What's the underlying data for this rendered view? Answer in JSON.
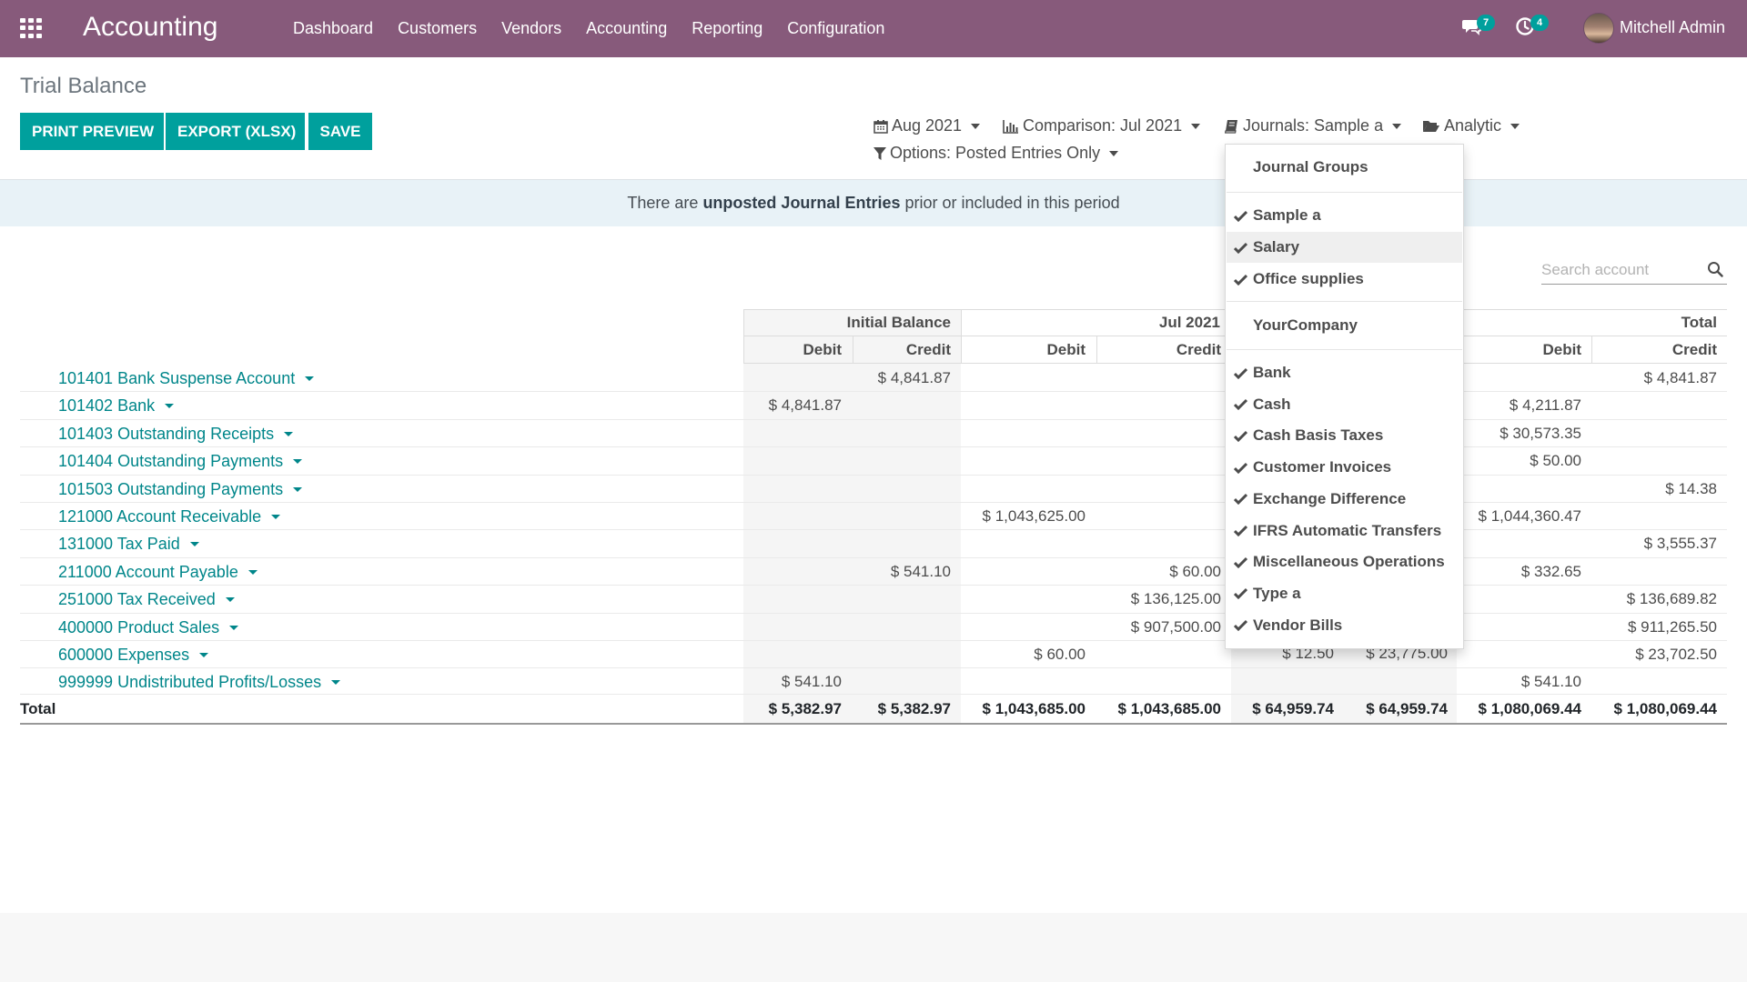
{
  "navbar": {
    "brand": "Accounting",
    "menu": [
      "Dashboard",
      "Customers",
      "Vendors",
      "Accounting",
      "Reporting",
      "Configuration"
    ],
    "messages_badge": "7",
    "activities_badge": "4",
    "user_name": "Mitchell Admin"
  },
  "control_panel": {
    "title": "Trial Balance",
    "buttons": {
      "print_preview": "PRINT PREVIEW",
      "export": "EXPORT (XLSX)",
      "save": "SAVE"
    },
    "filters": {
      "date": "Aug 2021",
      "comparison": "Comparison: Jul 2021",
      "journals": "Journals: Sample a",
      "analytic": "Analytic",
      "options": "Options: Posted Entries Only"
    }
  },
  "banner": {
    "prefix": "There are ",
    "strong": "unposted Journal Entries",
    "suffix": " prior or included in this period"
  },
  "search": {
    "placeholder": "Search account"
  },
  "report": {
    "groups": {
      "initial": "Initial Balance",
      "jul": "Jul 2021",
      "total": "Total"
    },
    "sub": {
      "debit": "Debit",
      "credit": "Credit"
    },
    "rows": [
      {
        "account": "101401 Bank Suspense Account",
        "init_debit": "",
        "init_credit": "$ 4,841.87",
        "jul_debit": "",
        "jul_credit": "",
        "tot_debit": "",
        "tot_credit": "$ 4,841.87"
      },
      {
        "account": "101402 Bank",
        "init_debit": "$ 4,841.87",
        "init_credit": "",
        "jul_debit": "",
        "jul_credit": "",
        "tot_debit": "$ 4,211.87",
        "tot_credit": ""
      },
      {
        "account": "101403 Outstanding Receipts",
        "init_debit": "",
        "init_credit": "",
        "jul_debit": "",
        "jul_credit": "",
        "tot_debit": "$ 30,573.35",
        "tot_credit": ""
      },
      {
        "account": "101404 Outstanding Payments",
        "init_debit": "",
        "init_credit": "",
        "jul_debit": "",
        "jul_credit": "",
        "tot_debit": "$ 50.00",
        "tot_credit": ""
      },
      {
        "account": "101503 Outstanding Payments",
        "init_debit": "",
        "init_credit": "",
        "jul_debit": "",
        "jul_credit": "",
        "tot_debit": "",
        "tot_credit": "$ 14.38"
      },
      {
        "account": "121000 Account Receivable",
        "init_debit": "",
        "init_credit": "",
        "jul_debit": "$ 1,043,625.00",
        "jul_credit": "",
        "tot_debit": "$ 1,044,360.47",
        "tot_credit": ""
      },
      {
        "account": "131000 Tax Paid",
        "init_debit": "",
        "init_credit": "",
        "jul_debit": "",
        "jul_credit": "",
        "tot_debit": "",
        "tot_credit": "$ 3,555.37"
      },
      {
        "account": "211000 Account Payable",
        "init_debit": "",
        "init_credit": "$ 541.10",
        "jul_debit": "",
        "jul_credit": "$ 60.00",
        "tot_debit": "$ 332.65",
        "tot_credit": ""
      },
      {
        "account": "251000 Tax Received",
        "init_debit": "",
        "init_credit": "",
        "jul_debit": "",
        "jul_credit": "$ 136,125.00",
        "tot_debit": "",
        "tot_credit": "$ 136,689.82"
      },
      {
        "account": "400000 Product Sales",
        "init_debit": "",
        "init_credit": "",
        "jul_debit": "",
        "jul_credit": "$ 907,500.00",
        "tot_debit": "",
        "tot_credit": "$ 911,265.50"
      },
      {
        "account": "600000 Expenses",
        "init_debit": "",
        "init_credit": "",
        "jul_debit": "$ 60.00",
        "jul_credit": "",
        "tot_debit": "",
        "tot_credit": "$ 23,702.50"
      },
      {
        "account": "999999 Undistributed Profits/Losses",
        "init_debit": "$ 541.10",
        "init_credit": "",
        "jul_debit": "",
        "jul_credit": "",
        "tot_debit": "$ 541.10",
        "tot_credit": ""
      }
    ],
    "partial": {
      "row10_aug_debit": "$ 12.50",
      "row10_aug_credit": "$ 23,775.00"
    },
    "total": {
      "label": "Total",
      "init_debit": "$ 5,382.97",
      "init_credit": "$ 5,382.97",
      "jul_debit": "$ 1,043,685.00",
      "jul_credit": "$ 1,043,685.00",
      "aug_debit": "$ 64,959.74",
      "aug_credit": "$ 64,959.74",
      "tot_debit": "$ 1,080,069.44",
      "tot_credit": "$ 1,080,069.44"
    }
  },
  "dropdown": {
    "groups_header": "Journal Groups",
    "groups": [
      "Sample a",
      "Salary",
      "Office supplies"
    ],
    "company_header": "YourCompany",
    "journals": [
      "Bank",
      "Cash",
      "Cash Basis Taxes",
      "Customer Invoices",
      "Exchange Difference",
      "IFRS Automatic Transfers",
      "Miscellaneous Operations",
      "Type a",
      "Vendor Bills"
    ]
  }
}
